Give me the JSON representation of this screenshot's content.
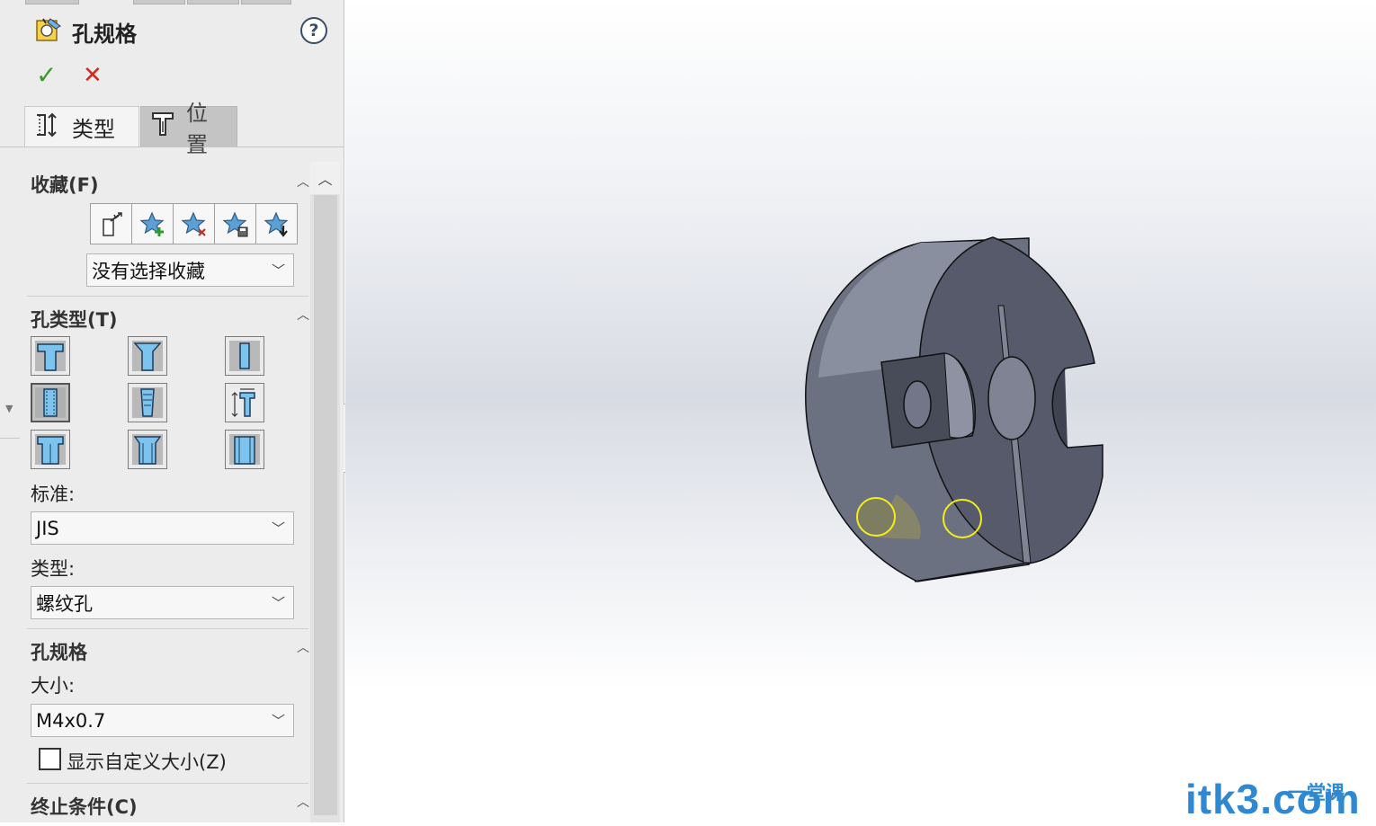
{
  "panel": {
    "title": "孔规格",
    "help": "?",
    "ok": "✓",
    "cancel": "✕",
    "tabs": [
      {
        "label": "类型"
      },
      {
        "label": "位置"
      }
    ]
  },
  "favorites": {
    "header": "收藏(F)",
    "buttons": [
      "use-default-icon",
      "add-favorite-icon",
      "delete-favorite-icon",
      "save-favorite-icon",
      "load-favorite-icon"
    ],
    "selected": "没有选择收藏"
  },
  "hole_type": {
    "header": "孔类型(T)",
    "standard_label": "标准:",
    "standard_value": "JIS",
    "type_label": "类型:",
    "type_value": "螺纹孔",
    "types": [
      "counterbore",
      "countersink",
      "hole",
      "straight-tap",
      "tapered-tap",
      "legacy",
      "counterbore-slot",
      "countersink-slot",
      "slot"
    ]
  },
  "hole_spec": {
    "header": "孔规格",
    "size_label": "大小:",
    "size_value": "M4x0.7",
    "custom_size_label": "显示自定义大小(Z)"
  },
  "end_condition": {
    "header": "终止条件(C)"
  },
  "watermark": {
    "main": "itk3.com",
    "sub": "一堂课"
  },
  "colors": {
    "ok": "#3a9a2a",
    "cancel": "#d9261c",
    "model": "#5a5e70",
    "sketch_circle": "#f2ee1a",
    "watermark": "#2f88d0"
  }
}
